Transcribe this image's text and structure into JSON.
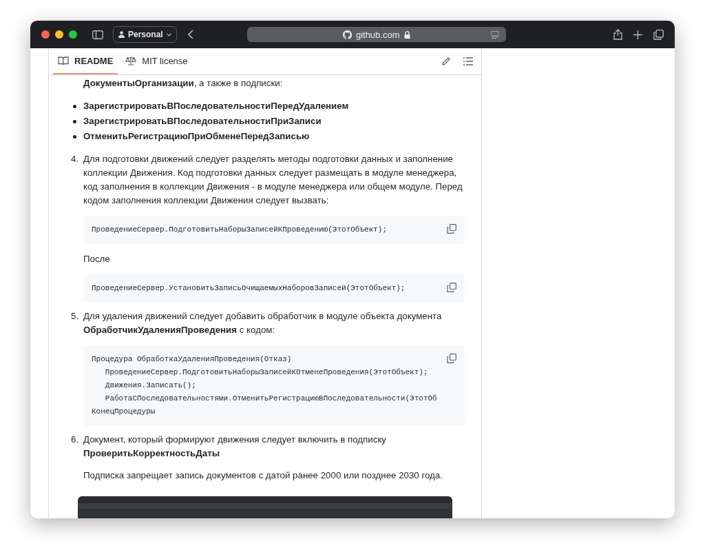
{
  "browser": {
    "profile": "Personal",
    "url": "github.com"
  },
  "tabs": [
    {
      "label": "README",
      "selected": true
    },
    {
      "label": "MIT license",
      "selected": false
    }
  ],
  "intro": "**ДокументыОрганизации**, а также в подписки:",
  "bullets": [
    "ЗарегистрироватьВПоследовательностиПередУдалением",
    "ЗарегистрироватьВПоследовательностиПриЗаписи",
    "ОтменитьРегистрациюПриОбменеПередЗаписью"
  ],
  "items": [
    {
      "number": "4.",
      "blocks": [
        {
          "kind": "text",
          "text": "Для подготовки движений следует разделять методы подготовки данных и заполнение коллекции Движения. Код подготовки данных следует размещать в модуле менеджера, код заполнения в коллекции Движения - в модуле менеджера или общем модуле. Перед кодом заполнения коллекции Движения следует вызвать:"
        },
        {
          "kind": "code",
          "lines": [
            "ПроведениеСервер.ПодготовитьНаборыЗаписейКПроведению(ЭтотОбъект);"
          ]
        },
        {
          "kind": "text",
          "text": "После"
        },
        {
          "kind": "code",
          "lines": [
            "ПроведениеСервер.УстановитьЗаписьОчищаемыхНаборовЗаписей(ЭтотОбъект);"
          ]
        }
      ]
    },
    {
      "number": "5.",
      "blocks": [
        {
          "kind": "text",
          "text": "Для удаления движений следует добавить обработчик в модуле объекта документа **ОбработчикУдаленияПроведения** с кодом:"
        },
        {
          "kind": "code",
          "lines": [
            "Процедура ОбработкаУдаленияПроведения(Отказ)",
            "   ПроведениеСервер.ПодготовитьНаборыЗаписейКОтменеПроведения(ЭтотОбъект);",
            "   Движения.Записать();",
            "   РаботаСПоследовательностями.ОтменитьРегистрациюВПоследовательности(ЭтотОб",
            "КонецПроцедуры"
          ]
        }
      ]
    },
    {
      "number": "6.",
      "blocks": [
        {
          "kind": "text",
          "text": "Документ, который формируют движения следует включить в подписку **ПроверитьКорректностьДаты**"
        },
        {
          "kind": "text",
          "text": "Подписка запрещает запись документов с датой ранее 2000 или позднее 2030 года."
        },
        {
          "kind": "image"
        }
      ]
    }
  ]
}
